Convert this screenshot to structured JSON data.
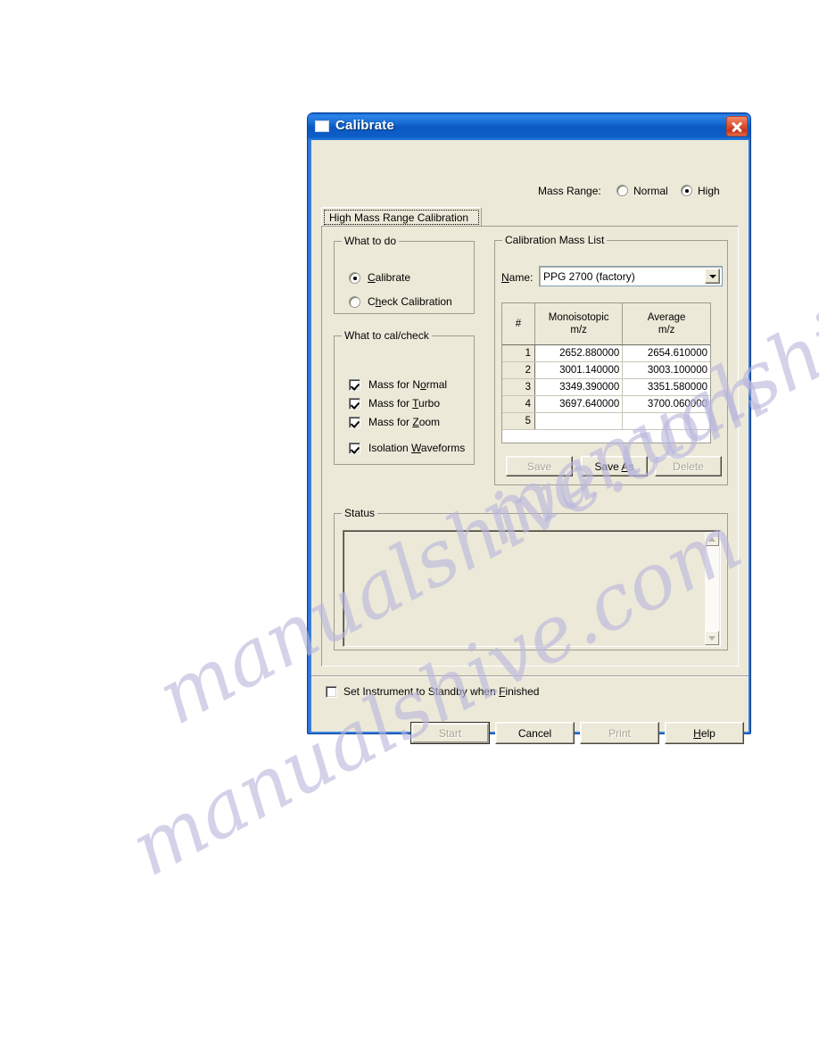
{
  "window": {
    "title": "Calibrate",
    "icon": "window-icon",
    "close_label": "Close"
  },
  "mass_range": {
    "label": "Mass Range:",
    "options": [
      "Normal",
      "High"
    ],
    "selected": "High"
  },
  "tab": {
    "label": "High Mass Range Calibration"
  },
  "what_to_do": {
    "title": "What to do",
    "options": [
      {
        "label": "Calibrate",
        "mnemonic": "C",
        "checked": true
      },
      {
        "label": "Check Calibration",
        "mnemonic": "h",
        "checked": false
      }
    ]
  },
  "what_to_cal_check": {
    "title": "What to cal/check",
    "items": [
      {
        "label": "Mass for Normal",
        "mnemonic": "N",
        "checked": true
      },
      {
        "label": "Mass for Turbo",
        "mnemonic": "T",
        "checked": true
      },
      {
        "label": "Mass for Zoom",
        "mnemonic": "Z",
        "checked": true
      },
      {
        "label": "Isolation Waveforms",
        "mnemonic": "W",
        "checked": true
      }
    ]
  },
  "calibration_mass_list": {
    "title": "Calibration Mass List",
    "name_label": "Name:",
    "name_mnemonic": "N",
    "selected_list": "PPG 2700 (factory)",
    "dropdown_icon": "chevron-down-icon",
    "columns": [
      "#",
      "Monoisotopic\nm/z",
      "Average\nm/z"
    ],
    "column_headers": [
      {
        "line1": "#",
        "line2": ""
      },
      {
        "line1": "Monoisotopic",
        "line2": "m/z"
      },
      {
        "line1": "Average",
        "line2": "m/z"
      }
    ],
    "rows": [
      {
        "index": "1",
        "monoisotopic": "2652.880000",
        "average": "2654.610000"
      },
      {
        "index": "2",
        "monoisotopic": "3001.140000",
        "average": "3003.100000"
      },
      {
        "index": "3",
        "monoisotopic": "3349.390000",
        "average": "3351.580000"
      },
      {
        "index": "4",
        "monoisotopic": "3697.640000",
        "average": "3700.060000"
      },
      {
        "index": "5",
        "monoisotopic": "",
        "average": ""
      }
    ],
    "buttons": [
      {
        "label": "Save",
        "enabled": false
      },
      {
        "label": "Save As",
        "enabled": true
      },
      {
        "label": "Delete",
        "enabled": false
      }
    ]
  },
  "status": {
    "title": "Status",
    "text": "",
    "scrollbar": {
      "up_icon": "scroll-up-icon",
      "down_icon": "scroll-down-icon"
    }
  },
  "standby": {
    "label": "Set Instrument to Standby when Finished",
    "mnemonic": "F",
    "checked": false
  },
  "footer": {
    "buttons": [
      {
        "label": "Start",
        "enabled": false,
        "default": true
      },
      {
        "label": "Cancel",
        "enabled": true,
        "default": false
      },
      {
        "label": "Print",
        "enabled": false,
        "default": false
      },
      {
        "label": "Help",
        "enabled": true,
        "default": false,
        "mnemonic": "H"
      }
    ]
  },
  "watermark": {
    "line1": "manualshive.com",
    "line2": "manualshive.com",
    "line3": "manualshive.com"
  },
  "colors": {
    "dialog_face": "#ece9d8",
    "titlebar_blue": "#0b57c0",
    "close_red": "#c7341c",
    "field_white": "#ffffff"
  }
}
